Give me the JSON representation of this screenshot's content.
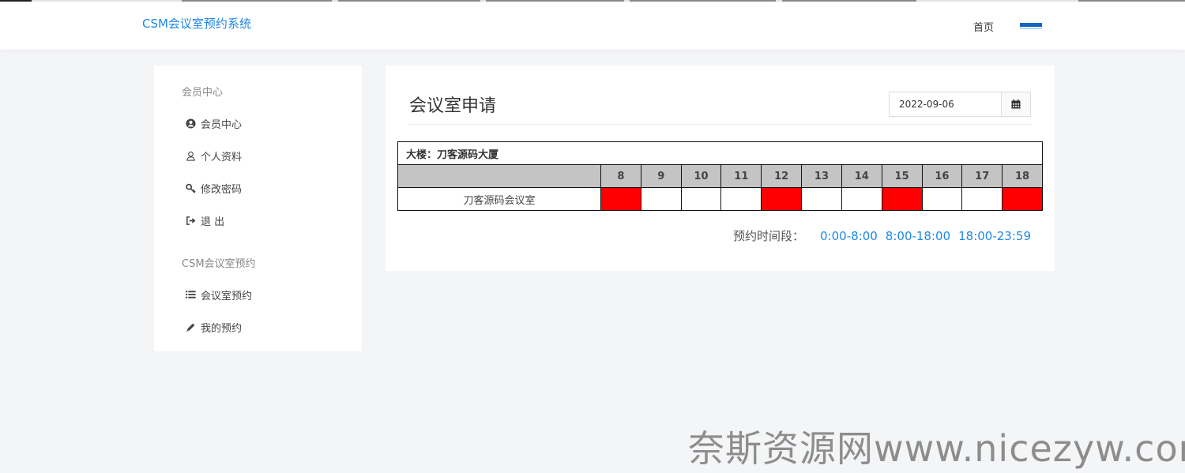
{
  "header": {
    "brand": "CSM会议室预约系统",
    "home": "首页"
  },
  "sidebar": {
    "sections": [
      {
        "title": "会员中心",
        "items": [
          {
            "label": "会员中心",
            "icon": "user-circle-icon"
          },
          {
            "label": "个人资料",
            "icon": "user-icon"
          },
          {
            "label": "修改密码",
            "icon": "key-icon"
          },
          {
            "label": "退 出",
            "icon": "sign-out-icon"
          }
        ]
      },
      {
        "title": "CSM会议室预约",
        "items": [
          {
            "label": "会议室预约",
            "icon": "list-icon"
          },
          {
            "label": "我的预约",
            "icon": "pencil-icon"
          }
        ]
      }
    ]
  },
  "main": {
    "title": "会议室申请",
    "date": "2022-09-06",
    "building": "大楼：刀客源码大厦",
    "hours": [
      "8",
      "9",
      "10",
      "11",
      "12",
      "13",
      "14",
      "15",
      "16",
      "17",
      "18"
    ],
    "rooms": [
      {
        "name": "刀客源码会议室",
        "slots": [
          true,
          false,
          false,
          false,
          true,
          false,
          false,
          true,
          false,
          false,
          true
        ]
      }
    ],
    "legend": {
      "label": "预约时间段：",
      "ranges": [
        "0:00-8:00",
        "8:00-18:00",
        "18:00-23:59"
      ]
    }
  },
  "colors": {
    "accent": "#1e88e5",
    "busy": "#ff0000",
    "header_row": "#c4c4c4"
  },
  "watermark": "奈斯资源网www.nicezyw.com"
}
